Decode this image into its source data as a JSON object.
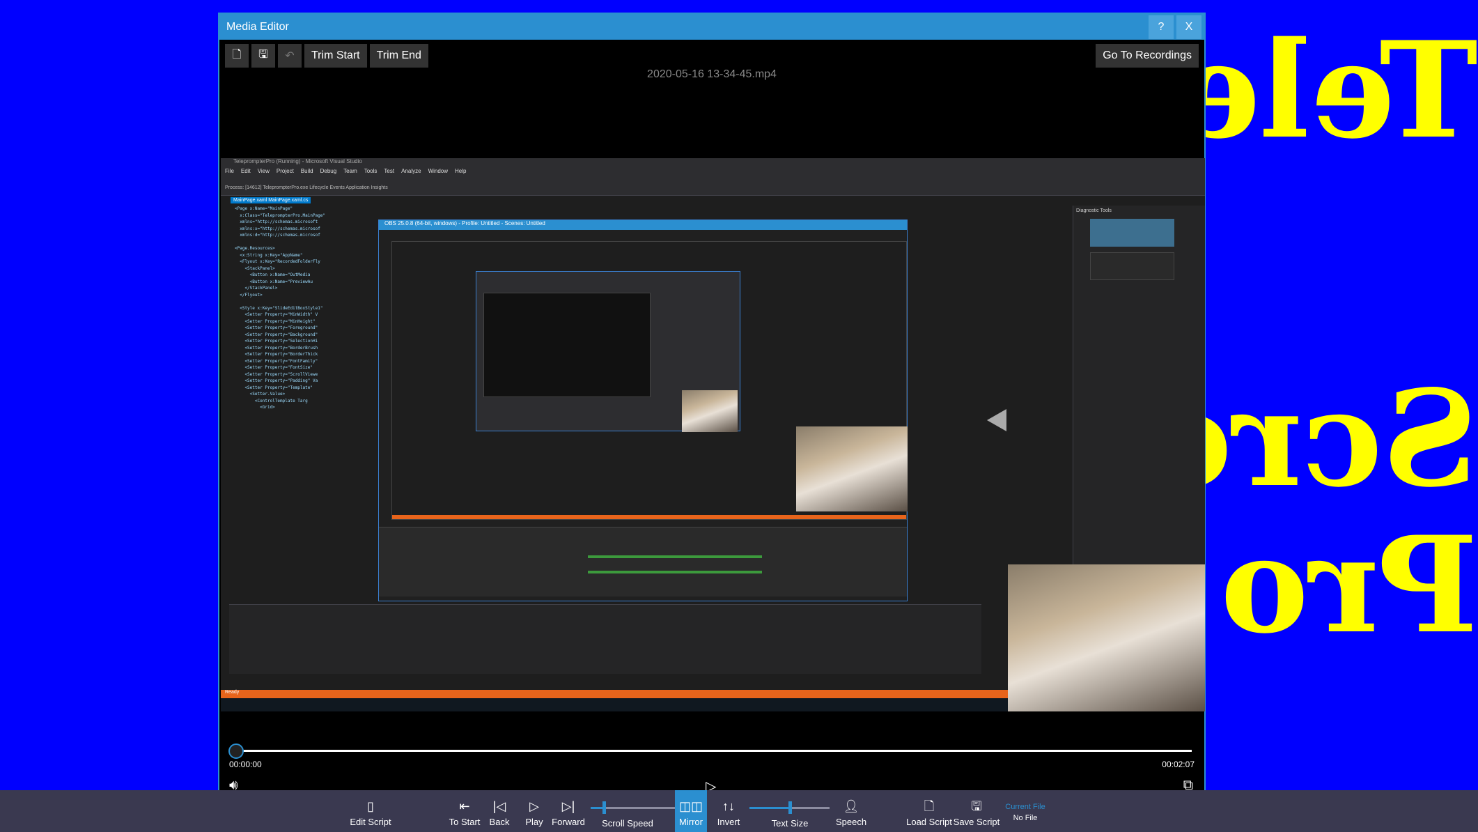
{
  "background_text": [
    "Teleprompter",
    "Scroll",
    "Pro f"
  ],
  "window": {
    "title": "Media Editor",
    "help_label": "?",
    "close_label": "X",
    "toolbar": {
      "new_icon": "new-file-icon",
      "save_icon": "save-icon",
      "undo_icon": "undo-icon",
      "trim_start": "Trim Start",
      "trim_end": "Trim End",
      "go_to_recordings": "Go To Recordings"
    },
    "filename": "2020-05-16 13-34-45.mp4"
  },
  "video": {
    "vs_title": "TeleprompterPro (Running) - Microsoft Visual Studio",
    "vs_menu": [
      "File",
      "Edit",
      "View",
      "Project",
      "Build",
      "Debug",
      "Team",
      "Tools",
      "Test",
      "Analyze",
      "Window",
      "Help"
    ],
    "vs_process": "Process: [14612] TeleprompterPro.exe   Lifecycle Events   Application Insights",
    "vs_tabs": "MainPage.xaml  MainPage.xaml.cs",
    "obs_title": "OBS 25.0.8 (64-bit, windows) - Profile: Untitled - Scenes: Untitled",
    "diag_title": "Diagnostic Tools",
    "status": "Ready"
  },
  "player": {
    "current_time": "00:00:00",
    "total_time": "00:02:07",
    "progress": 0,
    "volume_icon": "volume-icon",
    "play_icon": "play-icon",
    "fullscreen_icon": "fullscreen-icon"
  },
  "bottom_bar": {
    "edit_script": "Edit Script",
    "to_start": "To Start",
    "back": "Back",
    "play": "Play",
    "forward": "Forward",
    "scroll_speed": "Scroll Speed",
    "scroll_speed_value": 0.15,
    "mirror": "Mirror",
    "invert": "Invert",
    "text_size": "Text Size",
    "text_size_value": 0.5,
    "speech": "Speech",
    "load_script": "Load Script",
    "save_script": "Save Script",
    "current_file_label": "Current File",
    "current_file_value": "No File",
    "accent": "#2b8fd0"
  }
}
